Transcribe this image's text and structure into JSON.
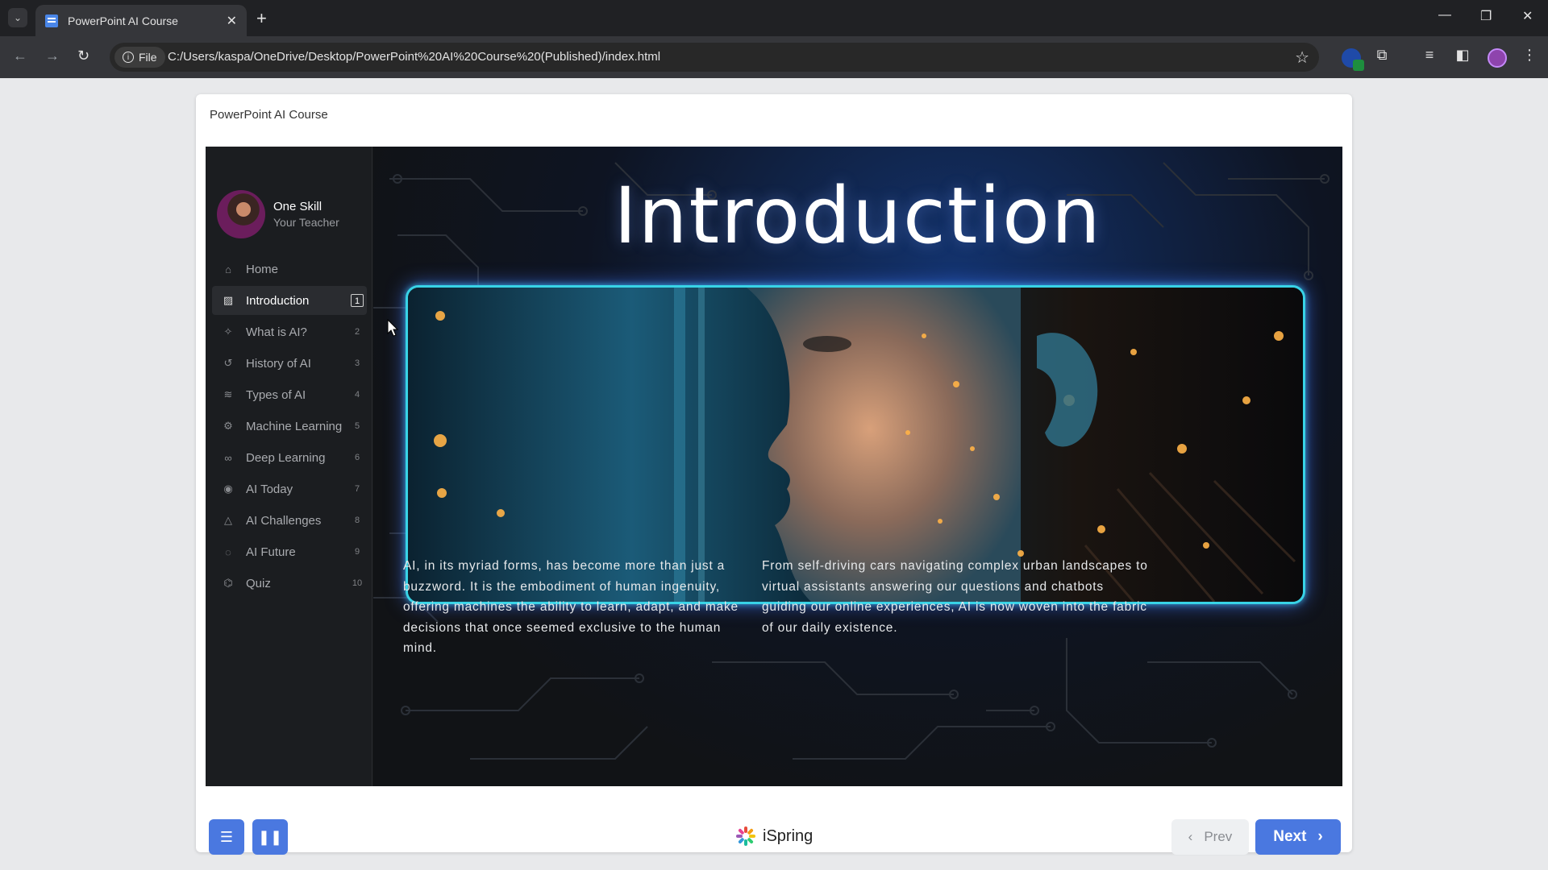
{
  "browser": {
    "tab_title": "PowerPoint AI Course",
    "site_chip": "File",
    "url": "C:/Users/kaspa/OneDrive/Desktop/PowerPoint%20AI%20Course%20(Published)/index.html"
  },
  "player": {
    "title": "PowerPoint AI Course",
    "teacher": {
      "name": "One Skill",
      "role": "Your Teacher"
    },
    "menu": [
      {
        "label": "Home",
        "num": "",
        "icon": "home-icon",
        "active": false
      },
      {
        "label": "Introduction",
        "num": "1",
        "icon": "image-icon",
        "active": true
      },
      {
        "label": "What is AI?",
        "num": "2",
        "icon": "sparkle-icon",
        "active": false
      },
      {
        "label": "History of AI",
        "num": "3",
        "icon": "history-icon",
        "active": false
      },
      {
        "label": "Types of AI",
        "num": "4",
        "icon": "layers-icon",
        "active": false
      },
      {
        "label": "Machine Learning",
        "num": "5",
        "icon": "gear-icon",
        "active": false
      },
      {
        "label": "Deep Learning",
        "num": "6",
        "icon": "binoculars-icon",
        "active": false
      },
      {
        "label": "AI Today",
        "num": "7",
        "icon": "location-icon",
        "active": false
      },
      {
        "label": "AI Challenges",
        "num": "8",
        "icon": "warning-icon",
        "active": false
      },
      {
        "label": "AI Future",
        "num": "9",
        "icon": "planet-icon",
        "active": false
      },
      {
        "label": "Quiz",
        "num": "10",
        "icon": "graduation-cap-icon",
        "active": false
      }
    ],
    "slide": {
      "title": "Introduction",
      "paragraph_left": "AI, in its myriad forms, has become more than just a buzzword. It is the embodiment of human ingenuity, offering machines the ability to learn, adapt, and make decisions that once seemed exclusive to the human mind.",
      "paragraph_right": "From self-driving cars navigating complex urban landscapes to virtual assistants answering our questions and chatbots guiding our online experiences, AI is now woven into the fabric of our daily existence."
    },
    "footer": {
      "brand": "iSpring",
      "prev_label": "Prev",
      "next_label": "Next"
    }
  },
  "colors": {
    "accent": "#4a78e0",
    "frame_glow": "#38d3e6"
  }
}
